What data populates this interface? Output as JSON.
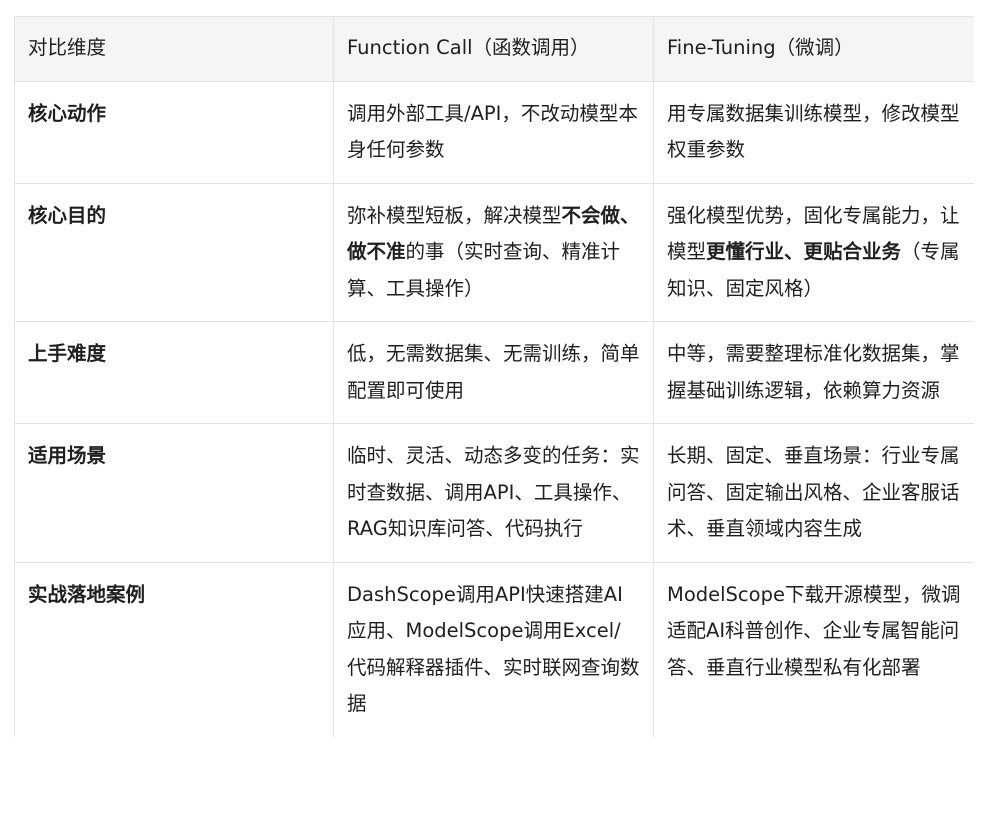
{
  "table": {
    "headers": [
      "对比维度",
      "Function Call（函数调用）",
      "Fine-Tuning（微调）"
    ],
    "rows": [
      {
        "dimension": "核心动作",
        "function_call": [
          {
            "text": "调用外部工具/API，不改动模型本身任何参数",
            "bold": false
          }
        ],
        "fine_tuning": [
          {
            "text": "用专属数据集训练模型，修改模型权重参数",
            "bold": false
          }
        ]
      },
      {
        "dimension": "核心目的",
        "function_call": [
          {
            "text": "弥补模型短板，解决模型",
            "bold": false
          },
          {
            "text": "不会做、做不准",
            "bold": true
          },
          {
            "text": "的事（实时查询、精准计算、工具操作）",
            "bold": false
          }
        ],
        "fine_tuning": [
          {
            "text": "强化模型优势，固化专属能力，让模型",
            "bold": false
          },
          {
            "text": "更懂行业、更贴合业务",
            "bold": true
          },
          {
            "text": "（专属知识、固定风格）",
            "bold": false
          }
        ]
      },
      {
        "dimension": "上手难度",
        "function_call": [
          {
            "text": "低，无需数据集、无需训练，简单配置即可使用",
            "bold": false
          }
        ],
        "fine_tuning": [
          {
            "text": "中等，需要整理标准化数据集，掌握基础训练逻辑，依赖算力资源",
            "bold": false
          }
        ]
      },
      {
        "dimension": "适用场景",
        "function_call": [
          {
            "text": "临时、灵活、动态多变的任务：实时查数据、调用API、工具操作、RAG知识库问答、代码执行",
            "bold": false
          }
        ],
        "fine_tuning": [
          {
            "text": "长期、固定、垂直场景：行业专属问答、固定输出风格、企业客服话术、垂直领域内容生成",
            "bold": false
          }
        ]
      },
      {
        "dimension": "实战落地案例",
        "function_call": [
          {
            "text": "DashScope调用API快速搭建AI应用、ModelScope调用Excel/代码解释器插件、实时联网查询数据",
            "bold": false
          }
        ],
        "fine_tuning": [
          {
            "text": "ModelScope下载开源模型，微调适配AI科普创作、企业专属智能问答、垂直行业模型私有化部署",
            "bold": false
          }
        ]
      }
    ]
  }
}
